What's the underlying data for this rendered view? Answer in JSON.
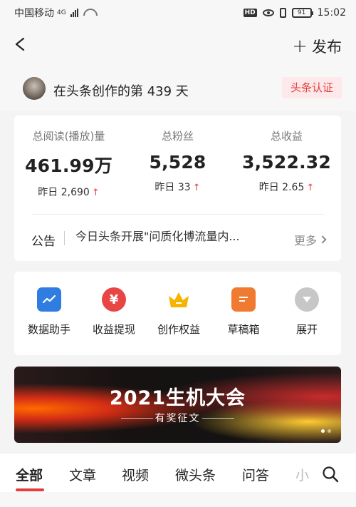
{
  "status_bar": {
    "carrier": "中国移动",
    "network": "4G",
    "hd": "HD",
    "battery": "91",
    "time": "15:02"
  },
  "header": {
    "publish_label": "发布"
  },
  "creator": {
    "text": "在头条创作的第 439 天",
    "verify_label": "头条认证"
  },
  "stats": [
    {
      "label": "总阅读(播放)量",
      "value": "461.99万",
      "delta": "昨日 2,690"
    },
    {
      "label": "总粉丝",
      "value": "5,528",
      "delta": "昨日 33"
    },
    {
      "label": "总收益",
      "value": "3,522.32",
      "delta": "昨日 2.65"
    }
  ],
  "notice": {
    "label": "公告",
    "text": "今日头条开展\"问质化博流量内...",
    "more": "更多"
  },
  "tools": [
    {
      "label": "数据助手",
      "icon": "chart-icon",
      "color": "#2f7de1"
    },
    {
      "label": "收益提现",
      "icon": "yuan-icon",
      "color": "#e84545"
    },
    {
      "label": "创作权益",
      "icon": "crown-icon",
      "color": "#f5b400"
    },
    {
      "label": "草稿箱",
      "icon": "draft-icon",
      "color": "#f07a30"
    },
    {
      "label": "展开",
      "icon": "expand-icon",
      "color": "#c7c7c7"
    }
  ],
  "banner": {
    "title": "2021生机大会",
    "subtitle": "有奖征文"
  },
  "tabs": [
    {
      "label": "全部"
    },
    {
      "label": "文章"
    },
    {
      "label": "视频"
    },
    {
      "label": "微头条"
    },
    {
      "label": "问答"
    },
    {
      "label": "小"
    }
  ],
  "colors": {
    "accent": "#e63b3b"
  }
}
